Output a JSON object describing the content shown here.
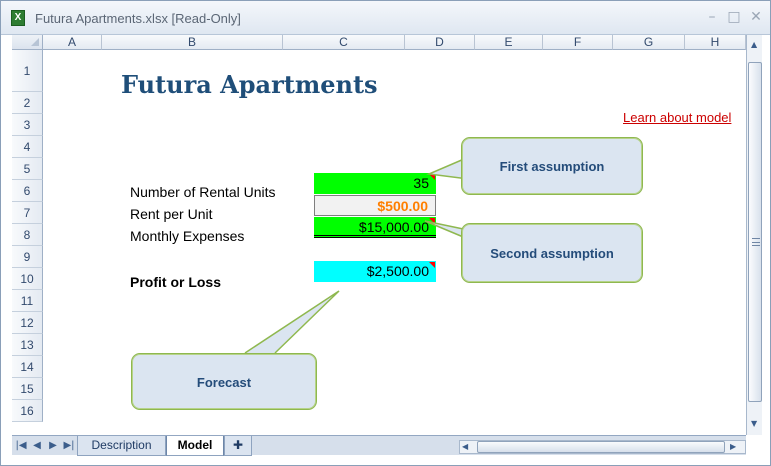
{
  "window": {
    "title": "Futura Apartments.xlsx  [Read-Only]",
    "icon": "excel-file-icon",
    "controls": [
      "minimize-icon",
      "maximize-icon",
      "close-icon"
    ]
  },
  "sheet": {
    "columns": [
      "A",
      "B",
      "C",
      "D",
      "E",
      "F",
      "G",
      "H"
    ],
    "rows": [
      "1",
      "2",
      "3",
      "4",
      "5",
      "6",
      "7",
      "8",
      "9",
      "10",
      "11",
      "12",
      "13",
      "14",
      "15",
      "16"
    ],
    "title": "Futura Apartments",
    "learn_link": "Learn about model",
    "inputs": [
      {
        "label": "Number of Rental Units",
        "value": "35",
        "fill": "#00ff00"
      },
      {
        "label": "Rent per Unit",
        "value": "$500.00",
        "fill": "#f2f2f2",
        "text_color": "#ff7f00"
      },
      {
        "label": "Monthly Expenses",
        "value": "$15,000.00",
        "fill": "#00ff00"
      }
    ],
    "result": {
      "label": "Profit or Loss",
      "value": "$2,500.00",
      "fill": "#00ffff"
    }
  },
  "callouts": [
    {
      "text": "First assumption"
    },
    {
      "text": "Second assumption"
    },
    {
      "text": "Forecast"
    }
  ],
  "tabs": [
    {
      "label": "Description"
    },
    {
      "label": "Model"
    }
  ]
}
